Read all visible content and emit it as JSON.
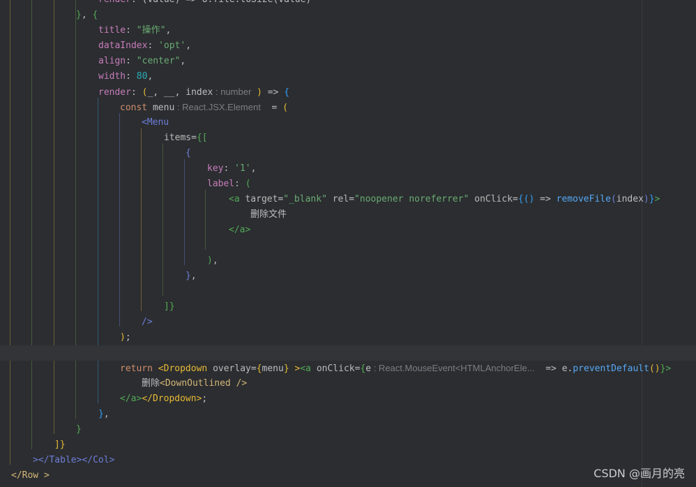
{
  "editor": {
    "colors": {
      "background": "#2b2d30",
      "current_line": "#323438",
      "right_margin": "#393b40",
      "default_text": "#bcbec4",
      "property_key": "#c77dbb",
      "string": "#6aab73",
      "number": "#2aacb8",
      "keyword": "#cf8e6d",
      "function_call": "#56a8f5",
      "jsx_tag": "#d5b778",
      "jsx_attribute": "#bababa",
      "inlay_hint": "#7a7e85",
      "bracket_gold": "#e8ba36",
      "bracket_green": "#54a857",
      "bracket_blue": "#359ff4",
      "bracket_purple": "#6e7ed9",
      "watermark": "#c9ccd1"
    },
    "guide_colors": [
      "#6b5f36",
      "#465a3c",
      "#355a78",
      "#484d7a"
    ],
    "lines": [
      [
        {
          "t": "render",
          "c": "#c77dbb"
        },
        {
          "t": ": (value) => U.file.toSize(value)",
          "c": "#bcbec4"
        }
      ],
      [
        {
          "t": "}",
          "c": "#54a857"
        },
        {
          "t": ", ",
          "c": "#bcbec4"
        },
        {
          "t": "{",
          "c": "#54a857"
        }
      ],
      [
        {
          "t": "title",
          "c": "#c77dbb"
        },
        {
          "t": ": ",
          "c": "#bcbec4"
        },
        {
          "t": "\"操作\"",
          "c": "#6aab73"
        },
        {
          "t": ",",
          "c": "#bcbec4"
        }
      ],
      [
        {
          "t": "dataIndex",
          "c": "#c77dbb"
        },
        {
          "t": ": ",
          "c": "#bcbec4"
        },
        {
          "t": "'opt'",
          "c": "#6aab73"
        },
        {
          "t": ",",
          "c": "#bcbec4"
        }
      ],
      [
        {
          "t": "align",
          "c": "#c77dbb"
        },
        {
          "t": ": ",
          "c": "#bcbec4"
        },
        {
          "t": "\"center\"",
          "c": "#6aab73"
        },
        {
          "t": ",",
          "c": "#bcbec4"
        }
      ],
      [
        {
          "t": "width",
          "c": "#c77dbb"
        },
        {
          "t": ": ",
          "c": "#bcbec4"
        },
        {
          "t": "80",
          "c": "#2aacb8"
        },
        {
          "t": ",",
          "c": "#bcbec4"
        }
      ],
      [
        {
          "t": "render",
          "c": "#c77dbb"
        },
        {
          "t": ": ",
          "c": "#bcbec4"
        },
        {
          "t": "(",
          "c": "#e8ba36"
        },
        {
          "t": "_, __, index",
          "c": "#bcbec4"
        },
        {
          "t": " : number",
          "k": "hint"
        },
        {
          "t": " ",
          "c": "#bcbec4"
        },
        {
          "t": ")",
          "c": "#e8ba36"
        },
        {
          "t": " => ",
          "c": "#bcbec4"
        },
        {
          "t": "{",
          "c": "#359ff4"
        }
      ],
      [
        {
          "t": "const ",
          "c": "#cf8e6d"
        },
        {
          "t": "menu",
          "c": "#bcbec4"
        },
        {
          "t": " : React.JSX.Element",
          "k": "hint"
        },
        {
          "t": "  = ",
          "c": "#bcbec4"
        },
        {
          "t": "(",
          "c": "#e8ba36"
        }
      ],
      [
        {
          "t": "<Menu",
          "c": "#6e7ed9"
        }
      ],
      [
        {
          "t": "items",
          "c": "#bababa"
        },
        {
          "t": "=",
          "c": "#bcbec4"
        },
        {
          "t": "{",
          "c": "#54a857"
        },
        {
          "t": "[",
          "c": "#54a857"
        }
      ],
      [
        {
          "t": "{",
          "c": "#6e7ed9"
        }
      ],
      [
        {
          "t": "key",
          "c": "#c77dbb"
        },
        {
          "t": ": ",
          "c": "#bcbec4"
        },
        {
          "t": "'1'",
          "c": "#6aab73"
        },
        {
          "t": ",",
          "c": "#bcbec4"
        }
      ],
      [
        {
          "t": "label",
          "c": "#c77dbb"
        },
        {
          "t": ": ",
          "c": "#bcbec4"
        },
        {
          "t": "(",
          "c": "#54a857"
        }
      ],
      [
        {
          "t": "<a ",
          "c": "#54a857"
        },
        {
          "t": "target",
          "c": "#bababa"
        },
        {
          "t": "=",
          "c": "#bcbec4"
        },
        {
          "t": "\"_blank\"",
          "c": "#6aab73"
        },
        {
          "t": " ",
          "c": "#bcbec4"
        },
        {
          "t": "rel",
          "c": "#bababa"
        },
        {
          "t": "=",
          "c": "#bcbec4"
        },
        {
          "t": "\"noopener noreferrer\"",
          "c": "#6aab73"
        },
        {
          "t": " ",
          "c": "#bcbec4"
        },
        {
          "t": "onClick",
          "c": "#bababa"
        },
        {
          "t": "=",
          "c": "#bcbec4"
        },
        {
          "t": "{",
          "c": "#359ff4"
        },
        {
          "t": "()",
          "c": "#359ff4"
        },
        {
          "t": " => ",
          "c": "#bcbec4"
        },
        {
          "t": "removeFile",
          "c": "#56a8f5"
        },
        {
          "t": "(",
          "c": "#6e7ed9"
        },
        {
          "t": "index",
          "c": "#bcbec4"
        },
        {
          "t": ")",
          "c": "#6e7ed9"
        },
        {
          "t": "}",
          "c": "#359ff4"
        },
        {
          "t": ">",
          "c": "#54a857"
        }
      ],
      [
        {
          "t": "删除文件",
          "c": "#bcbec4",
          "k": "cjk"
        }
      ],
      [
        {
          "t": "</a>",
          "c": "#54a857"
        }
      ],
      [],
      [
        {
          "t": ")",
          "c": "#54a857"
        },
        {
          "t": ",",
          "c": "#bcbec4"
        }
      ],
      [
        {
          "t": "}",
          "c": "#6e7ed9"
        },
        {
          "t": ",",
          "c": "#bcbec4"
        }
      ],
      [],
      [
        {
          "t": "]",
          "c": "#54a857"
        },
        {
          "t": "}",
          "c": "#54a857"
        }
      ],
      [
        {
          "t": "/>",
          "c": "#6e7ed9"
        }
      ],
      [
        {
          "t": ")",
          "c": "#e8ba36"
        },
        {
          "t": ";",
          "c": "#bcbec4"
        }
      ],
      [],
      [
        {
          "t": "return ",
          "c": "#cf8e6d"
        },
        {
          "t": "<Dropdown ",
          "c": "#e8ba36"
        },
        {
          "t": "overlay",
          "c": "#bababa"
        },
        {
          "t": "=",
          "c": "#bcbec4"
        },
        {
          "t": "{",
          "c": "#e8ba36"
        },
        {
          "t": "menu",
          "c": "#bcbec4"
        },
        {
          "t": "}",
          "c": "#e8ba36"
        },
        {
          "t": " ",
          "c": "#bcbec4"
        },
        {
          "t": ">",
          "c": "#e8ba36"
        },
        {
          "t": "<a ",
          "c": "#54a857"
        },
        {
          "t": "onClick",
          "c": "#bababa"
        },
        {
          "t": "=",
          "c": "#bcbec4"
        },
        {
          "t": "{",
          "c": "#54a857"
        },
        {
          "t": "e",
          "c": "#bcbec4"
        },
        {
          "t": " : React.MouseEvent<HTMLAnchorEle...",
          "k": "hint"
        },
        {
          "t": "  => ",
          "c": "#bcbec4"
        },
        {
          "t": "e",
          "c": "#bcbec4"
        },
        {
          "t": ".",
          "c": "#bcbec4"
        },
        {
          "t": "preventDefault",
          "c": "#56a8f5"
        },
        {
          "t": "()",
          "c": "#e8ba36"
        },
        {
          "t": "}",
          "c": "#54a857"
        },
        {
          "t": ">",
          "c": "#54a857"
        }
      ],
      [
        {
          "t": "删除",
          "c": "#bcbec4",
          "k": "cjk"
        },
        {
          "t": "<DownOutlined ",
          "c": "#d5b778"
        },
        {
          "t": "/>",
          "c": "#d5b778"
        }
      ],
      [
        {
          "t": "</a>",
          "c": "#54a857"
        },
        {
          "t": "</Dropdown>",
          "c": "#e8ba36"
        },
        {
          "t": ";",
          "c": "#bcbec4"
        }
      ],
      [
        {
          "t": "}",
          "c": "#359ff4"
        },
        {
          "t": ",",
          "c": "#bcbec4"
        }
      ],
      [
        {
          "t": "}",
          "c": "#54a857"
        }
      ],
      [
        {
          "t": "]",
          "c": "#e8ba36"
        },
        {
          "t": "}",
          "c": "#e8ba36"
        }
      ],
      [
        {
          "t": "></Table></Col>",
          "c": "#6e7ed9"
        }
      ],
      [
        {
          "t": "</Row ",
          "c": "#d5b778"
        },
        {
          "t": ">",
          "c": "#d5b778"
        }
      ]
    ]
  },
  "watermark": "CSDN @画月的亮"
}
